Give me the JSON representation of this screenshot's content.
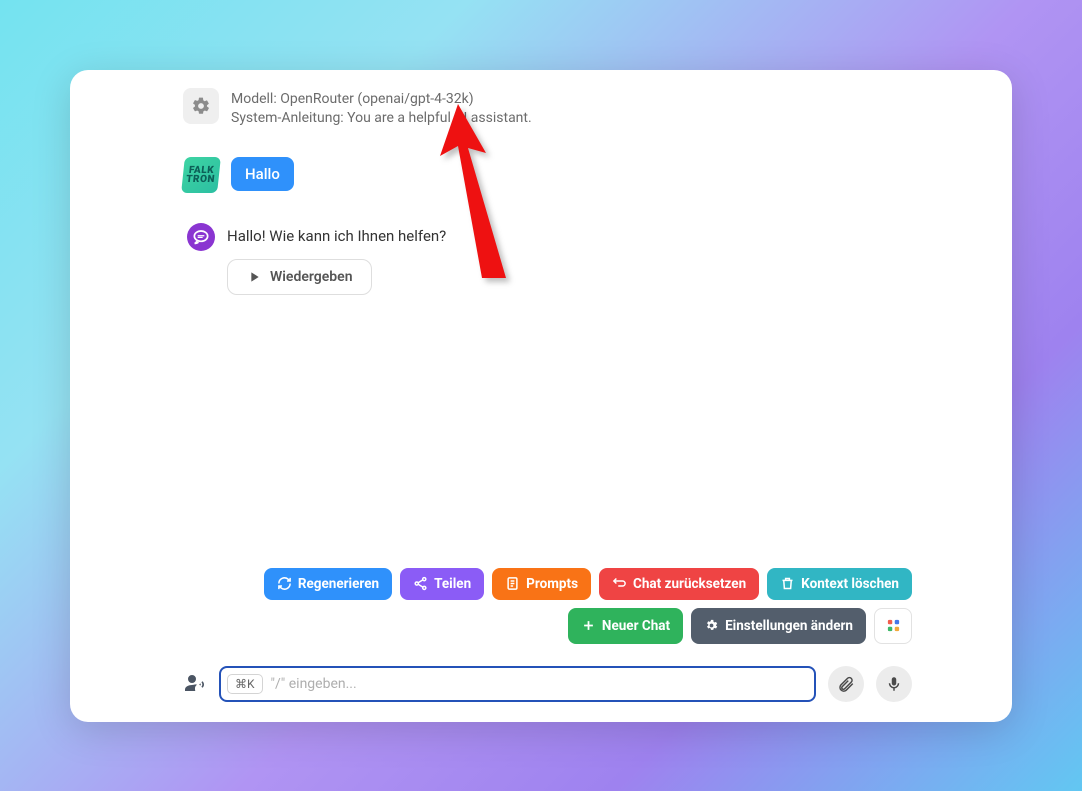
{
  "system": {
    "model_line": "Modell: OpenRouter (openai/gpt-4-32k)",
    "instruction_line": "System-Anleitung: You are a helpful AI assistant."
  },
  "user_avatar_label": "FALK TRON",
  "messages": {
    "user": "Hallo",
    "assistant": "Hallo! Wie kann ich Ihnen helfen?"
  },
  "playback": {
    "label": "Wiedergeben"
  },
  "actions": {
    "regenerate": "Regenerieren",
    "share": "Teilen",
    "prompts": "Prompts",
    "reset_chat": "Chat zurücksetzen",
    "clear_context": "Kontext löschen",
    "new_chat": "Neuer Chat",
    "change_settings": "Einstellungen ändern"
  },
  "input": {
    "shortcut": "⌘K",
    "placeholder": "\"/\" eingeben..."
  }
}
